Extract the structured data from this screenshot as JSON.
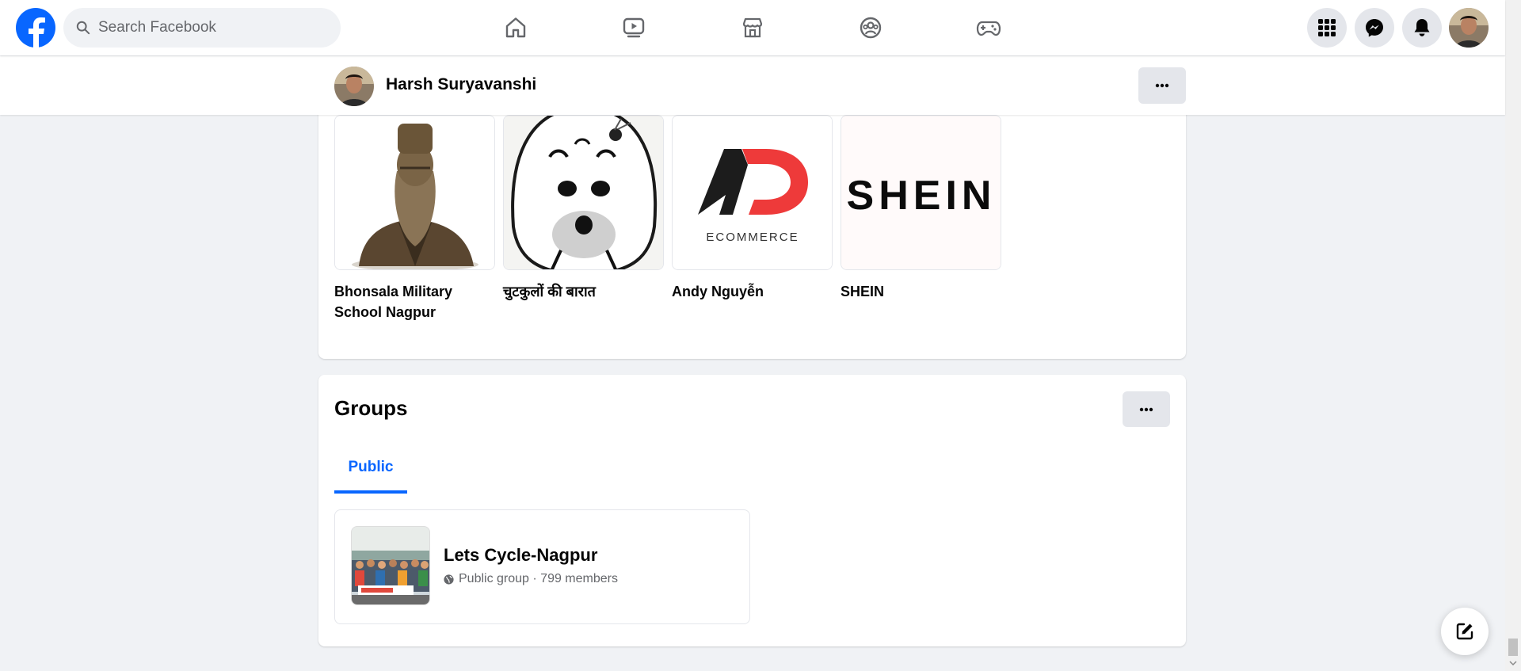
{
  "search": {
    "placeholder": "Search Facebook"
  },
  "nav": {
    "items": [
      {
        "icon": "home-icon"
      },
      {
        "icon": "video-icon"
      },
      {
        "icon": "marketplace-icon"
      },
      {
        "icon": "groups-icon"
      },
      {
        "icon": "gaming-icon"
      }
    ]
  },
  "profile_bar": {
    "name": "Harsh Suryavanshi"
  },
  "likes": {
    "items": [
      {
        "name": "Bhonsala Military School Nagpur"
      },
      {
        "name": "चुटकुलों की बारात"
      },
      {
        "name": "Andy Nguyễn"
      },
      {
        "name": "SHEIN"
      }
    ],
    "logo_texts": {
      "ad_sub": "ECOMMERCE",
      "shein": "SHEIN"
    }
  },
  "groups": {
    "title": "Groups",
    "tab_public": "Public",
    "items": [
      {
        "name": "Lets Cycle-Nagpur",
        "meta": "Public group · 799 members"
      }
    ]
  },
  "colors": {
    "brand": "#0866ff",
    "background": "#f0f2f5",
    "secondary_text": "#65676b"
  }
}
